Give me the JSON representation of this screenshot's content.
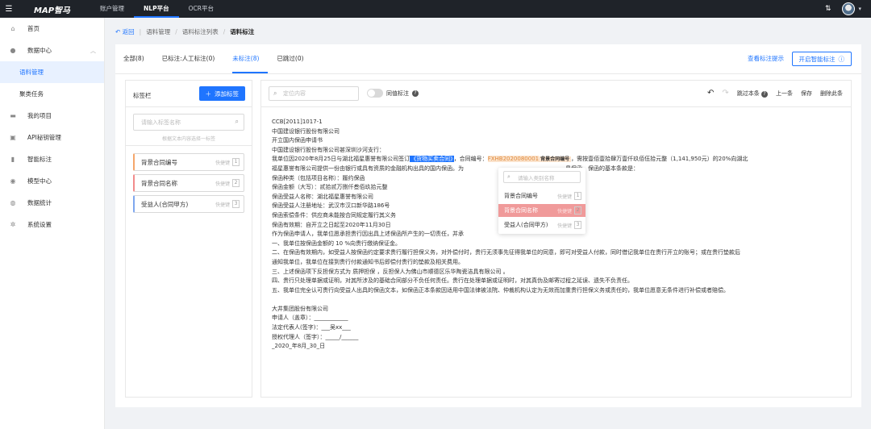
{
  "topbar": {
    "logo": "MAP智马",
    "nav": [
      "账户管理",
      "NLP平台",
      "OCR平台"
    ],
    "active_nav": "NLP平台"
  },
  "sidebar": {
    "items": [
      {
        "label": "首页",
        "icon": "home-icon"
      },
      {
        "label": "数据中心",
        "icon": "data-center-icon"
      },
      {
        "label": "语料管理"
      },
      {
        "label": "聚类任务"
      },
      {
        "label": "我的项目",
        "icon": "folder-icon"
      },
      {
        "label": "API秘钥管理",
        "icon": "api-key-icon"
      },
      {
        "label": "智能标注",
        "icon": "tag-icon"
      },
      {
        "label": "模型中心",
        "icon": "model-icon"
      },
      {
        "label": "数据统计",
        "icon": "stats-icon"
      },
      {
        "label": "系统设置",
        "icon": "settings-icon"
      }
    ]
  },
  "breadcrumb": {
    "back": "返回",
    "items": [
      "语料管理",
      "语料标注列表",
      "语料标注"
    ]
  },
  "tabs": [
    "全部(8)",
    "已标注:人工标注(0)",
    "未标注(8)",
    "已跳过(0)"
  ],
  "header_actions": {
    "view_tips": "查看标注提示",
    "smart_label": "开启智能标注"
  },
  "label_panel": {
    "title": "标签栏",
    "add_button": "添加标签",
    "search_placeholder": "请输入标签名称",
    "hint": "根据文本内容选择一标签",
    "shortcut_label": "快捷键",
    "labels": [
      {
        "name": "背景合同编号",
        "key": "1",
        "color": "#f5a66b"
      },
      {
        "name": "背景合同名称",
        "key": "2",
        "color": "#f28b8b"
      },
      {
        "name": "受益人(合同甲方)",
        "key": "3",
        "color": "#7fa7ee"
      }
    ]
  },
  "editor": {
    "search_placeholder": "定位内容",
    "same_label": "同值标注",
    "skip": "跳过本条",
    "prev": "上一条",
    "save": "保存",
    "delete": "删除此条",
    "document": {
      "lines": [
        "CCB[2011]1017-1",
        "中国建设银行股份有限公司",
        "开立国内保函申请书",
        "中国建设银行股份有限公司甚深圳沙河支行：",
        "",
        "福星惠誉有限公司提供一份由银行或具有资质的金融机构出具的国内保函。为",
        "保函种类（包括项目名称）：履约保函",
        "保函金额（大写）：贰拾贰万捌仟叁佰玖拾元整",
        "保函受益人名称：湖北福星惠誉有限公司",
        "保函受益人注册地址：武汉市汉口新华路186号",
        "保函索偿条件：供应商未能按合同规定履行其义务",
        "保函有效期：自开立之日起至2020年11月30日",
        "作为保函申请人，我单位愿承担贵行因出具上述保函所产生的一切责任，并承",
        "一、我单位按保函金额的 10 %向贵行缴纳保证金。",
        "二、在保函有效期内，如受益人按保函约定要求贵行履行担保义务，对外偿付时，贵行无须事先征得我单位的同意，即可对受益人付款，同时借记我单位在贵行开立的账号；或在贵行垫款后",
        "通知我单位，我单位在接到贵行付款通知书后即偿付贵行的垫款及相关费用。",
        "三、上述保函项下反担保方式为 质押担保 ，反担保人为佛山市顺德区乐华陶瓷洁具有限公司 。",
        "四、贵行只处理单据或证明，对其所涉及的基础合同部分不负任何责任。贵行在处理单据或证明时，对其真伪及邮寄过程之延误、遗失不负责任。",
        "五、我单位完全认可贵行向受益人出具的保函文本，如保函正本条款因适用中国法律被法院、仲裁机构认定为无效而加重贵行担保义务或责任的，我单位愿意无条件进行补偿或者赔偿。",
        "",
        "大井集团股份有限公司",
        "申请人（盖章）：____________",
        "法定代表人(签字)：___吴xx___",
        "授权代理人（签字）：_____/______",
        "_2020_年8月_30_日"
      ],
      "line5_before": "我单位因2020年8月25日与湖北福星惠誉有限公司签订",
      "line5_hl_contract": "《货物买卖合同》",
      "line5_mid": "，合同编号：",
      "line5_hl_number": "FXHB2020080001",
      "line5_tag": "背景合同编号",
      "line5_after": "，需按壹佰壹拾肆万壹仟玖佰伍拾元整（1,141,950元）的20%向湖北",
      "line6_tail": "具保函。保函的基本条款是："
    }
  },
  "popup": {
    "search_placeholder": "请输入类别名称",
    "shortcut_label": "快捷键",
    "items": [
      {
        "name": "背景合同编号",
        "key": "1"
      },
      {
        "name": "背景合同名称",
        "key": "2"
      },
      {
        "name": "受益人(合同甲方)",
        "key": "3"
      }
    ]
  }
}
